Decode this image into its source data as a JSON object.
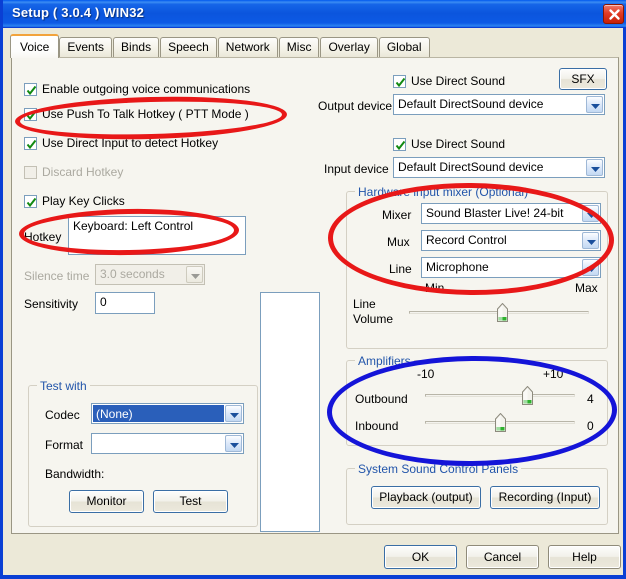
{
  "window": {
    "title": "Setup ( 3.0.4 ) WIN32",
    "close_icon": "close-icon",
    "titlebar_color": "#0b55dd",
    "close_color": "#c52007"
  },
  "tabs": [
    {
      "label": "Voice",
      "active": true
    },
    {
      "label": "Events",
      "active": false
    },
    {
      "label": "Binds",
      "active": false
    },
    {
      "label": "Speech",
      "active": false
    },
    {
      "label": "Network",
      "active": false
    },
    {
      "label": "Misc",
      "active": false
    },
    {
      "label": "Overlay",
      "active": false
    },
    {
      "label": "Global",
      "active": false
    }
  ],
  "left": {
    "checkboxes": [
      {
        "label": "Enable outgoing voice communications",
        "checked": true,
        "disabled": false
      },
      {
        "label": "Use Push To Talk Hotkey ( PTT Mode )",
        "checked": true,
        "disabled": false
      },
      {
        "label": "Use Direct Input to detect Hotkey",
        "checked": true,
        "disabled": false
      },
      {
        "label": "Discard Hotkey",
        "checked": false,
        "disabled": true
      },
      {
        "label": "Play Key Clicks",
        "checked": true,
        "disabled": false
      }
    ],
    "hotkey_label": "Hotkey",
    "hotkey_value": "Keyboard: Left Control",
    "silence_label": "Silence time",
    "silence_value": "3.0 seconds",
    "sensitivity_label": "Sensitivity",
    "sensitivity_value": "0",
    "test_group": {
      "caption": "Test with",
      "codec_label": "Codec",
      "codec_value": "(None)",
      "format_label": "Format",
      "format_value": "",
      "bandwidth_label": "Bandwidth:",
      "monitor_button": "Monitor",
      "test_button": "Test"
    }
  },
  "right": {
    "sfx_button": "SFX",
    "output_use_ds_label": "Use Direct Sound",
    "output_use_ds_checked": true,
    "output_device_label": "Output device",
    "output_device_value": "Default DirectSound device",
    "input_use_ds_label": "Use Direct Sound",
    "input_use_ds_checked": true,
    "input_device_label": "Input device",
    "input_device_value": "Default DirectSound device",
    "mixer_group": {
      "caption": "Hardware input mixer (Optional)",
      "mixer_label": "Mixer",
      "mixer_value": "Sound Blaster Live! 24-bit",
      "mux_label": "Mux",
      "mux_value": "Record Control",
      "line_label": "Line",
      "line_value": "Microphone",
      "min_label": "Min",
      "max_label": "Max",
      "volume_label_1": "Line",
      "volume_label_2": "Volume",
      "volume_percent": 52
    },
    "amplifiers_group": {
      "caption": "Amplifiers",
      "min_label": "-10",
      "max_label": "+10",
      "outbound_label": "Outbound",
      "outbound_value": "4",
      "outbound_percent": 70,
      "inbound_label": "Inbound",
      "inbound_value": "0",
      "inbound_percent": 50
    },
    "panels_group": {
      "caption": "System Sound Control Panels",
      "playback_button": "Playback (output)",
      "recording_button": "Recording (Input)"
    }
  },
  "footer": {
    "ok": "OK",
    "cancel": "Cancel",
    "help": "Help"
  },
  "annotations": [
    {
      "shape": "ellipse",
      "color": "#e81818",
      "name": "ptt-hotkey-highlight"
    },
    {
      "shape": "ellipse",
      "color": "#e81818",
      "name": "hotkey-field-highlight"
    },
    {
      "shape": "ellipse",
      "color": "#e81818",
      "name": "hardware-mixer-highlight"
    },
    {
      "shape": "ellipse",
      "color": "#1414d8",
      "name": "amplifiers-highlight"
    }
  ]
}
